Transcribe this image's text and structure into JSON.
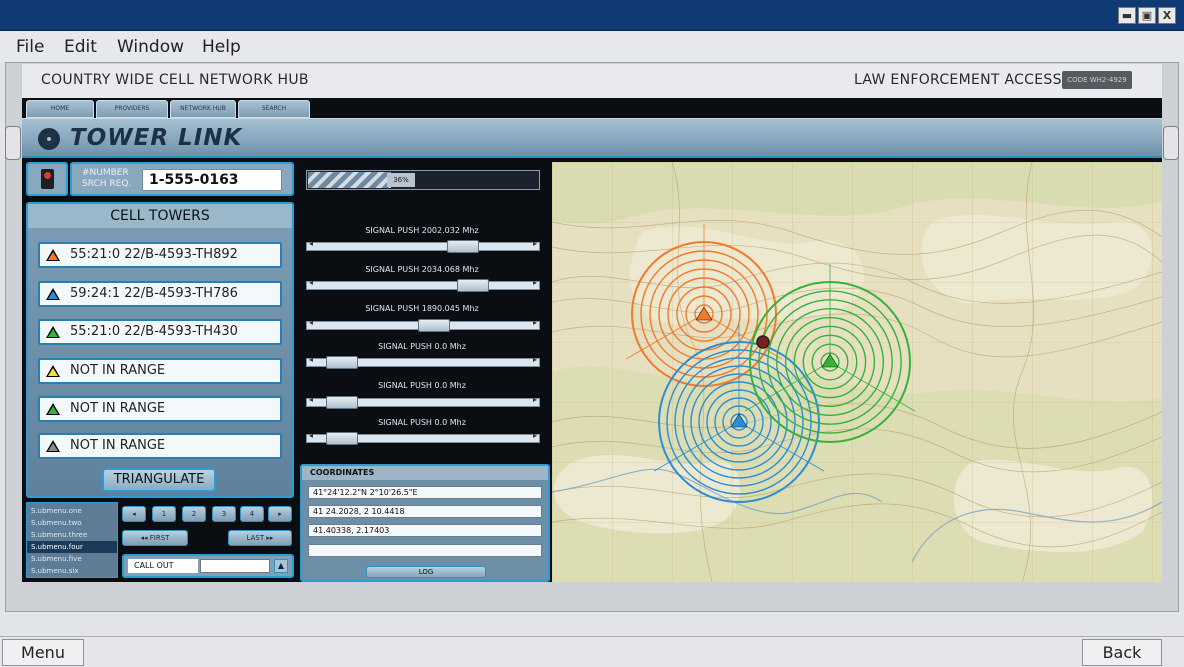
{
  "window": {
    "controls": [
      "minimize",
      "maximize",
      "close"
    ],
    "close_label": "X"
  },
  "menu": {
    "items": [
      "File",
      "Edit",
      "Window",
      "Help"
    ]
  },
  "header": {
    "hub_title": "COUNTRY WIDE CELL NETWORK HUB",
    "access_label": "LAW ENFORCEMENT ACCESS",
    "code_badge": "CODE WH2-4929"
  },
  "nav": {
    "tabs": [
      "HOME",
      "PROVIDERS",
      "NETWORK HUB",
      "SEARCH"
    ]
  },
  "brand": {
    "title": "TOWER LINK"
  },
  "search": {
    "label_line1": "#NUMBER",
    "label_line2": "SRCH REQ.",
    "number": "1-555-0163"
  },
  "towers": {
    "title": "CELL TOWERS",
    "items": [
      {
        "label": "55:21:0 22/B-4593-TH892",
        "color": "#f07a2a"
      },
      {
        "label": "59:24:1 22/B-4593-TH786",
        "color": "#2a8ed6"
      },
      {
        "label": "55:21:0 22/B-4593-TH430",
        "color": "#35b23a"
      },
      {
        "label": "NOT IN RANGE",
        "color": "#f2e23a"
      },
      {
        "label": "NOT IN RANGE",
        "color": "#35b23a"
      },
      {
        "label": "NOT IN RANGE",
        "color": "#8a8a8a"
      }
    ],
    "triangulate_label": "TRIANGULATE"
  },
  "submenu": {
    "items": [
      "S.ubmenu.one",
      "S.ubmenu.two",
      "S.ubmenu.three",
      "S.ubmenu.four",
      "S.ubmenu.five",
      "S.ubmenu.six"
    ],
    "active_index": 3
  },
  "pager": {
    "prev": "◂",
    "pages": [
      "1",
      "2",
      "3",
      "4"
    ],
    "next": "▸",
    "first": "◂◂ FIRST",
    "last": "LAST ▸▸"
  },
  "callout": {
    "label": "CALL OUT",
    "button": "▲"
  },
  "progress": {
    "percent": 0.36,
    "label": "36%"
  },
  "signals": [
    {
      "label": "SIGNAL PUSH 2002.032 Mhz",
      "level": 0.72
    },
    {
      "label": "SIGNAL PUSH 2034.068 Mhz",
      "level": 0.78
    },
    {
      "label": "SIGNAL PUSH 1890.045 Mhz",
      "level": 0.56
    },
    {
      "label": "SIGNAL PUSH 0.0 Mhz",
      "level": 0.05
    },
    {
      "label": "SIGNAL PUSH 0.0 Mhz",
      "level": 0.05
    },
    {
      "label": "SIGNAL PUSH 0.0 Mhz",
      "level": 0.05
    }
  ],
  "coordinates": {
    "title": "COORDINATES",
    "values": [
      "41°24'12.2\"N 2°10'26.5\"E",
      "41 24.2028, 2 10.4418",
      "41.40338, 2.17403",
      ""
    ],
    "log_label": "LOG"
  },
  "map": {
    "towers": [
      {
        "name": "orange",
        "color": "#f07a2a"
      },
      {
        "name": "blue",
        "color": "#2a8ed6"
      },
      {
        "name": "green",
        "color": "#35b23a"
      }
    ]
  },
  "bottom": {
    "menu_label": "Menu",
    "back_label": "Back"
  }
}
